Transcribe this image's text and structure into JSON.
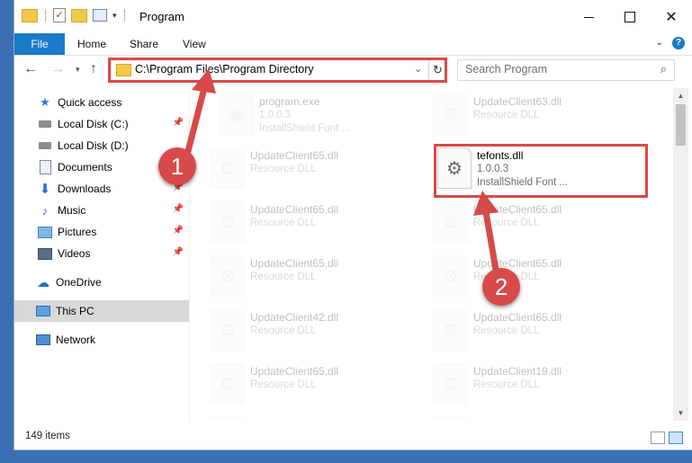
{
  "window": {
    "title": "Program",
    "controls": {
      "minimize": "—",
      "maximize": "☐",
      "close": "✕"
    }
  },
  "ribbon": {
    "tabs": [
      "File",
      "Home",
      "Share",
      "View"
    ],
    "help": "?"
  },
  "navigation": {
    "address_path": "C:\\Program Files\\Program Directory",
    "search_placeholder": "Search Program"
  },
  "sidebar": {
    "items": [
      {
        "label": "Quick access",
        "icon": "star-icon"
      },
      {
        "label": "Local Disk (C:)",
        "icon": "drive-icon",
        "pinned": true
      },
      {
        "label": "Local Disk (D:)",
        "icon": "drive-icon"
      },
      {
        "label": "Documents",
        "icon": "documents-icon",
        "pinned": true
      },
      {
        "label": "Downloads",
        "icon": "download-icon",
        "pinned": true
      },
      {
        "label": "Music",
        "icon": "music-icon",
        "pinned": true
      },
      {
        "label": "Pictures",
        "icon": "pictures-icon",
        "pinned": true
      },
      {
        "label": "Videos",
        "icon": "videos-icon",
        "pinned": true
      },
      {
        "label": "OneDrive",
        "icon": "cloud-icon"
      },
      {
        "label": "This PC",
        "icon": "computer-icon",
        "selected": true
      },
      {
        "label": "Network",
        "icon": "network-icon"
      }
    ]
  },
  "files": [
    {
      "name": "program.exe",
      "line2": "1.0.0.3",
      "line3": "InstallShield Font ..."
    },
    {
      "name": "UpdateClient63.dll",
      "line2": "Resource DLL"
    },
    {
      "name": "UpdateClient65.dll",
      "line2": "Resource DLL"
    },
    {
      "name": "tefonts.dll",
      "line2": "1.0.0.3",
      "line3": "InstallShield Font ...",
      "highlighted": true
    },
    {
      "name": "UpdateClient65.dll",
      "line2": "Resource DLL"
    },
    {
      "name": "UpdateClient65.dll",
      "line2": "Resource DLL"
    },
    {
      "name": "UpdateClient65.dll",
      "line2": "Resource DLL"
    },
    {
      "name": "UpdateClient65.dll",
      "line2": "Resource DLL"
    },
    {
      "name": "UpdateClient42.dll",
      "line2": "Resource DLL"
    },
    {
      "name": "UpdateClient65.dll",
      "line2": "Resource DLL"
    },
    {
      "name": "UpdateClient65.dll",
      "line2": "Resource DLL"
    },
    {
      "name": "UpdateClient19.dll",
      "line2": "Resource DLL"
    },
    {
      "name": "",
      "line2": ""
    },
    {
      "name": "",
      "line2": ""
    }
  ],
  "status": {
    "item_count": "149 items"
  },
  "annotations": {
    "step1": "1",
    "step2": "2",
    "color": "#d84a4a"
  }
}
